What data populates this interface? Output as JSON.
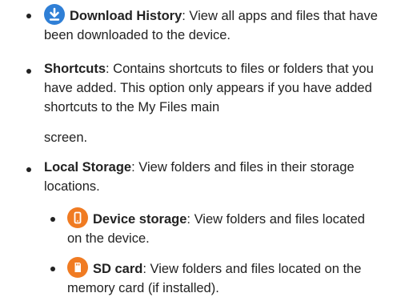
{
  "items": [
    {
      "icon": "download-icon",
      "term": "Download History",
      "desc": ": View all apps and files that have been downloaded to the device."
    },
    {
      "term": "Shortcuts",
      "desc_line1": ": Contains shortcuts to files or folders that you have added. This option only appears if you have added shortcuts to the My Files main",
      "desc_line2": "screen."
    },
    {
      "term": "Local Storage",
      "desc": ": View folders and files in their storage locations."
    }
  ],
  "sub_items": [
    {
      "icon": "device-storage-icon",
      "term": "Device storage",
      "desc": ": View folders and files located on the device."
    },
    {
      "icon": "sd-card-icon",
      "term": "SD card",
      "desc": ": View folders and files located on the memory card (if installed)."
    }
  ],
  "colors": {
    "download_icon": "#2f7fd6",
    "storage_icon": "#f07b22"
  }
}
